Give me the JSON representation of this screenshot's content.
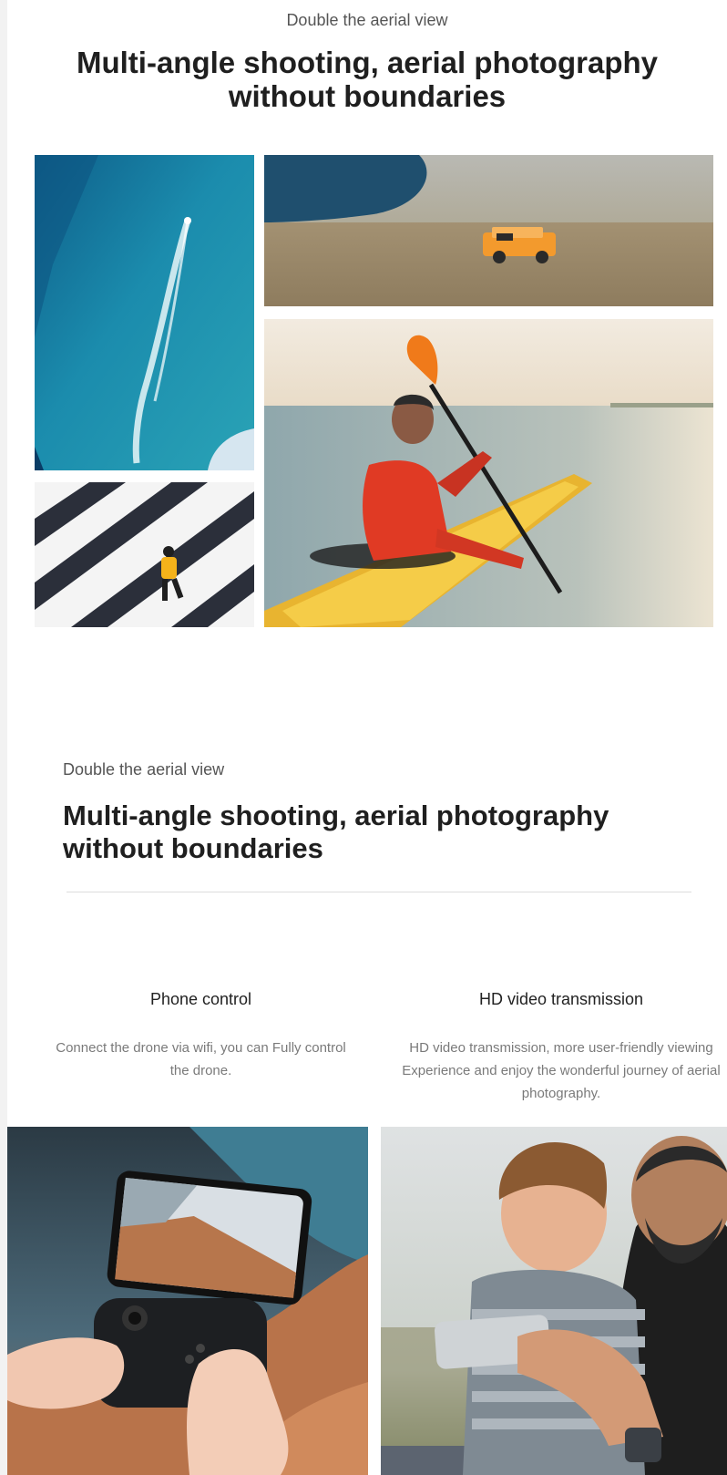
{
  "hero": {
    "subtitle": "Double the aerial view",
    "title": "Multi-angle shooting, aerial photography without boundaries"
  },
  "section2": {
    "subtitle": "Double the aerial view",
    "title": "Multi-angle shooting, aerial photography without boundaries"
  },
  "features": [
    {
      "title": "Phone control",
      "description": "Connect the drone via wifi, you can Fully control the drone."
    },
    {
      "title": "HD video transmission",
      "description": "HD video transmission, more user-friendly viewing Experience and enjoy the wonderful journey of aerial photography."
    }
  ],
  "colors": {
    "ocean": "#1f8fa8",
    "kayak_shirt": "#e03a24",
    "paddle": "#f07a1a",
    "car": "#f39a2d",
    "person_jacket": "#f5b21a"
  }
}
